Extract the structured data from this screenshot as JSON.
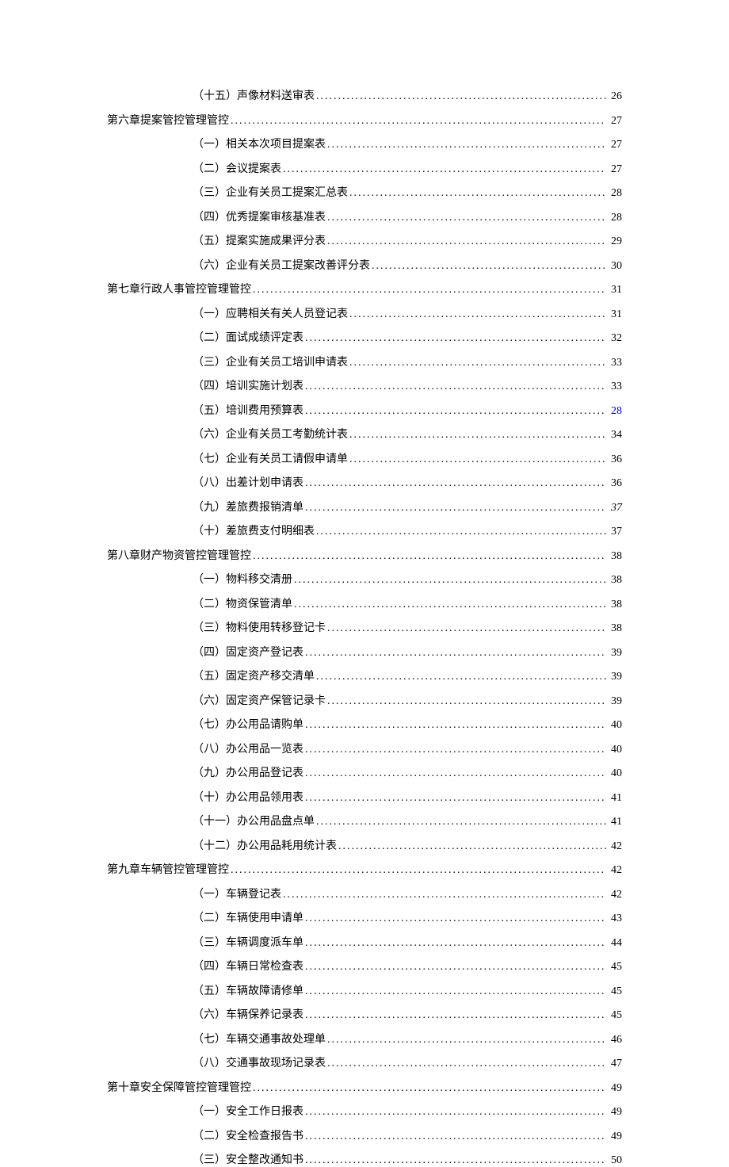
{
  "toc": [
    {
      "level": "sub",
      "title": "（十五）声像材料送审表",
      "page": "26"
    },
    {
      "level": "chapter",
      "title": "第六章提案管控管理管控 ",
      "page": "27"
    },
    {
      "level": "sub",
      "title": "（一）相关本次项目提案表",
      "page": "27"
    },
    {
      "level": "sub",
      "title": "（二）会议提案表",
      "page": "27"
    },
    {
      "level": "sub",
      "title": "（三）企业有关员工提案汇总表 ",
      "page": "28"
    },
    {
      "level": "sub",
      "title": "（四）优秀提案审核基准表",
      "page": "28"
    },
    {
      "level": "sub",
      "title": "（五）提案实施成果评分表",
      "page": "29"
    },
    {
      "level": "sub",
      "title": "（六）企业有关员工提案改善评分表",
      "page": "30"
    },
    {
      "level": "chapter",
      "title": "第七章行政人事管控管理管控 ",
      "page": "31"
    },
    {
      "level": "sub",
      "title": "（一）应聘相关有关人员登记表",
      "page": "31"
    },
    {
      "level": "sub",
      "title": "（二）面试成绩评定表",
      "page": "32"
    },
    {
      "level": "sub",
      "title": "（三）企业有关员工培训申请表 ",
      "page": "33"
    },
    {
      "level": "sub",
      "title": "（四）培训实施计划表",
      "page": "33"
    },
    {
      "level": "sub",
      "title": "（五）培训费用预算表",
      "page": "28",
      "pageClass": "link-color"
    },
    {
      "level": "sub",
      "title": "（六）企业有关员工考勤统计表",
      "page": "34"
    },
    {
      "level": "sub",
      "title": "（七）企业有关员工请假申请单",
      "page": "36"
    },
    {
      "level": "sub",
      "title": "（八）出差计划申请表",
      "page": "36"
    },
    {
      "level": "sub",
      "title": "（九）差旅费报销清单",
      "page": "37",
      "pageClass": "italic"
    },
    {
      "level": "sub",
      "title": "（十）差旅费支付明细表",
      "page": "37"
    },
    {
      "level": "chapter",
      "title": "第八章财产物资管控管理管控 ",
      "page": "38"
    },
    {
      "level": "sub",
      "title": "（一）物料移交清册",
      "page": "38"
    },
    {
      "level": "sub",
      "title": "（二）物资保管清单",
      "page": "38"
    },
    {
      "level": "sub",
      "title": "（三）物料使用转移登记卡 ",
      "page": "38"
    },
    {
      "level": "sub",
      "title": "（四）固定资产登记表",
      "page": "39"
    },
    {
      "level": "sub",
      "title": "（五）固定资产移交清单",
      "page": "39"
    },
    {
      "level": "sub",
      "title": "（六）固定资产保管记录卡",
      "page": "39"
    },
    {
      "level": "sub",
      "title": "（七）办公用品请购单",
      "page": "40"
    },
    {
      "level": "sub",
      "title": "（八）办公用品一览表",
      "page": "40"
    },
    {
      "level": "sub",
      "title": "（九）办公用品登记表",
      "page": "40"
    },
    {
      "level": "sub",
      "title": "（十）办公用品领用表",
      "page": "41"
    },
    {
      "level": "sub",
      "title": "（十一）办公用品盘点单",
      "page": "41"
    },
    {
      "level": "sub",
      "title": "（十二）办公用品耗用统计表",
      "page": "42"
    },
    {
      "level": "chapter",
      "title": "第九章车辆管控管理管控 ",
      "page": "42"
    },
    {
      "level": "sub",
      "title": "（一）车辆登记表",
      "page": "42"
    },
    {
      "level": "sub",
      "title": "（二）车辆使用申请单",
      "page": "43"
    },
    {
      "level": "sub",
      "title": "（三）车辆调度派车单 ",
      "page": "44"
    },
    {
      "level": "sub",
      "title": "（四）车辆日常检查表",
      "page": "45"
    },
    {
      "level": "sub",
      "title": "（五）车辆故障请修单",
      "page": "45"
    },
    {
      "level": "sub",
      "title": "（六）车辆保养记录表",
      "page": "45"
    },
    {
      "level": "sub",
      "title": "（七）车辆交通事故处理单",
      "page": "46"
    },
    {
      "level": "sub",
      "title": "（八）交通事故现场记录表 ",
      "page": "47"
    },
    {
      "level": "chapter",
      "title": "第十章安全保障管控管理管控 ",
      "page": "49"
    },
    {
      "level": "sub",
      "title": "（一）安全工作日报表",
      "page": "49"
    },
    {
      "level": "sub",
      "title": "（二）安全检查报告书",
      "page": "49"
    },
    {
      "level": "sub",
      "title": "（三）安全整改通知书 ",
      "page": "50"
    }
  ]
}
